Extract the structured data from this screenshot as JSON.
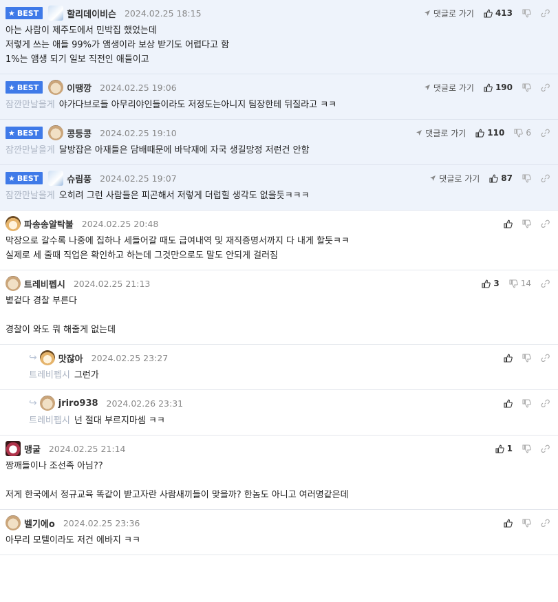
{
  "labels": {
    "best": "BEST",
    "reply_action": "댓글로 가기"
  },
  "colors": {
    "best_bg": "#eef3fb",
    "badge": "#3f7ae8"
  },
  "comments": [
    {
      "best": true,
      "avatar": "blue",
      "nick": "할리데이비슨",
      "date": "2024.02.25 18:15",
      "show_reply_link": true,
      "likes": "413",
      "dislikes": "",
      "quote": "",
      "lines": [
        "아는 사람이 제주도에서 민박집 했었는데",
        "저렇게 쓰는 애들 99%가 앰생이라 보상 받기도 어렵다고 함",
        "1%는 앰생 되기 일보 직전인 애들이고"
      ]
    },
    {
      "best": true,
      "avatar": "dog",
      "nick": "이땡깡",
      "date": "2024.02.25 19:06",
      "show_reply_link": true,
      "likes": "190",
      "dislikes": "",
      "quote": "잠깐만날을게",
      "lines": [
        "야가다브로들 아무리야인들이라도 저정도는아니지 팀장한테 뒤질라고 ㅋㅋ"
      ]
    },
    {
      "best": true,
      "avatar": "dog",
      "nick": "콩등콩",
      "date": "2024.02.25 19:10",
      "show_reply_link": true,
      "likes": "110",
      "dislikes": "6",
      "quote": "잠깐만날을게",
      "lines": [
        "달방잡은 아재들은 담배때문에 바닥재에 자국 생길망정 저런건 안함"
      ]
    },
    {
      "best": true,
      "avatar": "blue",
      "nick": "슈림풍",
      "date": "2024.02.25 19:07",
      "show_reply_link": true,
      "likes": "87",
      "dislikes": "",
      "quote": "잠깐만날을게",
      "lines": [
        "오히려 그런 사람들은 피곤해서 저렇게 더럽힐 생각도 없을듯ㅋㅋㅋ"
      ]
    },
    {
      "best": false,
      "avatar": "fox",
      "nick": "파송송알탁불",
      "date": "2024.02.25 20:48",
      "show_reply_link": false,
      "likes": "",
      "dislikes": "",
      "quote": "",
      "lines": [
        "막장으로 갈수록 나중에 집하나 세들어갈 때도 급여내역 및 재직증명서까지 다 내게 할듯ㅋㅋ",
        "실제로 세 줄때 직업은 확인하고 하는데 그것만으로도 말도 안되게 걸러짐"
      ]
    },
    {
      "best": false,
      "avatar": "dog",
      "nick": "트레비펩시",
      "date": "2024.02.25 21:13",
      "show_reply_link": false,
      "likes": "3",
      "dislikes": "14",
      "quote": "",
      "lines": [
        "볕겉다 경찰 부른다",
        "",
        "경찰이 와도 뭐 해줄게 없는데"
      ]
    },
    {
      "best": false,
      "reply": true,
      "avatar": "fox",
      "nick": "맛잖아",
      "date": "2024.02.25 23:27",
      "show_reply_link": false,
      "likes": "",
      "dislikes": "",
      "quote": "트레비펩시",
      "lines": [
        "그런가"
      ]
    },
    {
      "best": false,
      "reply": true,
      "avatar": "dog",
      "nick": "jriro938",
      "date": "2024.02.26 23:31",
      "show_reply_link": false,
      "likes": "",
      "dislikes": "",
      "quote": "트레비펩시",
      "lines": [
        "넌 절대 부르지마셈 ㅋㅋ"
      ]
    },
    {
      "best": false,
      "avatar": "red",
      "nick": "맹굴",
      "date": "2024.02.25 21:14",
      "show_reply_link": false,
      "likes": "1",
      "dislikes": "",
      "quote": "",
      "lines": [
        "짱깨들이나 조선족 아님??",
        "",
        "저게 한국에서 정규교육 똑같이 받고자란 사람새끼들이 맞을까? 한놈도 아니고 여러명같은데"
      ]
    },
    {
      "best": false,
      "avatar": "dog",
      "nick": "벨기에o",
      "date": "2024.02.25 23:36",
      "show_reply_link": false,
      "likes": "",
      "dislikes": "",
      "quote": "",
      "lines": [
        "아무리 모텔이라도 저건 에바지 ㅋㅋ"
      ]
    }
  ]
}
